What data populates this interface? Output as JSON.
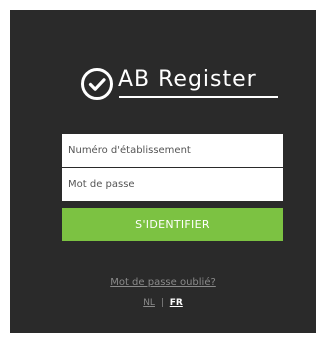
{
  "logo": {
    "brand": "AB Register",
    "icon": "check-circle-icon"
  },
  "form": {
    "establishment_placeholder": "Numéro d'établissement",
    "password_placeholder": "Mot de passe",
    "signin_label": "S'IDENTIFIER"
  },
  "links": {
    "forgot_password": "Mot de passe oublié?"
  },
  "languages": {
    "items": [
      {
        "label": "NL",
        "active": false
      },
      {
        "label": "FR",
        "active": true
      }
    ],
    "separator": "|"
  },
  "colors": {
    "panel_background": "#2a2a2a",
    "accent_green": "#7cc242",
    "link_gray": "#8a8a8a"
  }
}
